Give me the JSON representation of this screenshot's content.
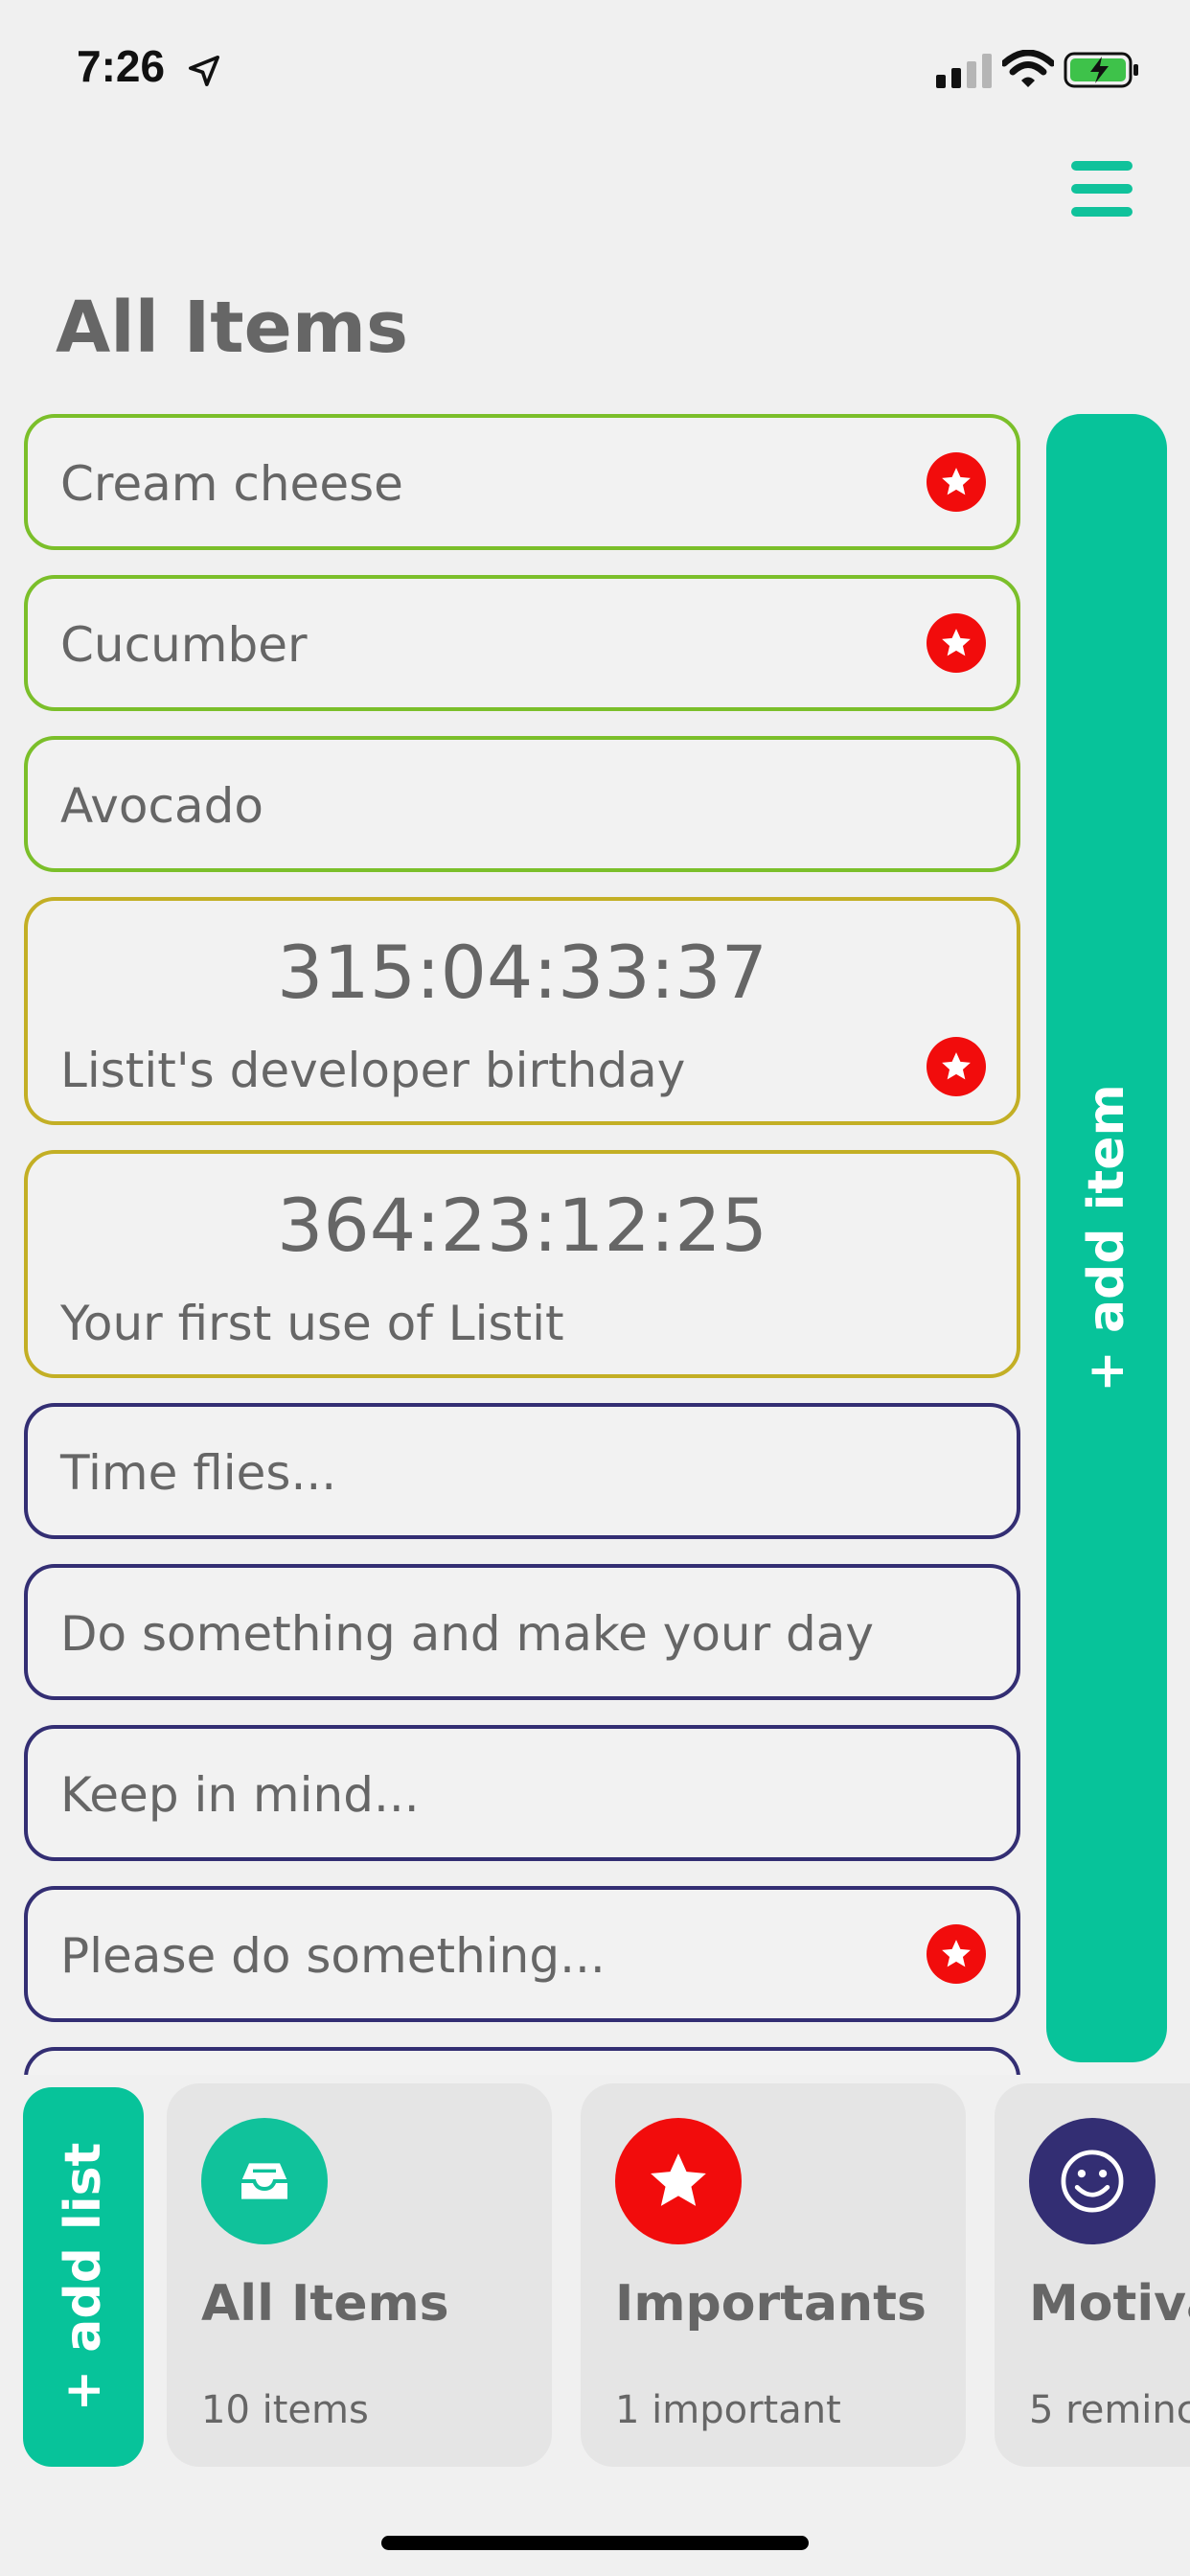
{
  "status_bar": {
    "time": "7:26",
    "icons": [
      "location-arrow-icon",
      "signal-icon",
      "wifi-icon",
      "battery-charging-icon"
    ]
  },
  "header": {
    "title": "All Items",
    "menu_icon": "hamburger-menu-icon"
  },
  "items": [
    {
      "text": "Cream cheese",
      "countdown": "",
      "important": true,
      "accent": "#7bbf2a"
    },
    {
      "text": "Cucumber",
      "countdown": "",
      "important": true,
      "accent": "#7bbf2a"
    },
    {
      "text": "Avocado",
      "countdown": "",
      "important": false,
      "accent": "#7bbf2a"
    },
    {
      "text": "Listit's developer birthday",
      "countdown": "315:04:33:37",
      "important": true,
      "accent": "#c3af25"
    },
    {
      "text": "Your first use of Listit",
      "countdown": "364:23:12:25",
      "important": false,
      "accent": "#c3af25"
    },
    {
      "text": "Time flies...",
      "countdown": "",
      "important": false,
      "accent": "#332e73"
    },
    {
      "text": "Do something and make your day",
      "countdown": "",
      "important": false,
      "accent": "#332e73"
    },
    {
      "text": "Keep in mind...",
      "countdown": "",
      "important": false,
      "accent": "#332e73"
    },
    {
      "text": "Please do something...",
      "countdown": "",
      "important": true,
      "accent": "#332e73"
    },
    {
      "text": "",
      "countdown": "",
      "important": false,
      "accent": "#332e73"
    }
  ],
  "add_item": {
    "label": "+ add item"
  },
  "add_list": {
    "label": "+ add list"
  },
  "lists": [
    {
      "name": "All Items",
      "count": "10 items",
      "icon": "inbox-tray-icon",
      "color": "#10c29b"
    },
    {
      "name": "Importants",
      "count": "1 important",
      "icon": "star-icon",
      "color": "#f20c0c"
    },
    {
      "name": "Motiva",
      "count": "5 reminc",
      "icon": "smiley-icon",
      "color": "#332e73"
    }
  ],
  "colors": {
    "accent": "#07c39a",
    "important": "#f20c0c",
    "background": "#f0f0f0",
    "text": "#666666"
  }
}
